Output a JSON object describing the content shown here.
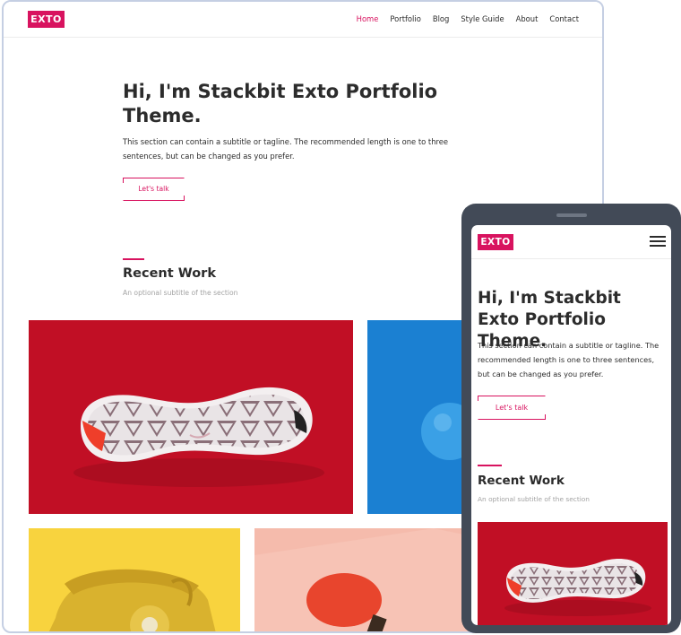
{
  "desktop": {
    "logo": "EXTO",
    "nav": [
      {
        "label": "Home",
        "active": true
      },
      {
        "label": "Portfolio",
        "active": false
      },
      {
        "label": "Blog",
        "active": false
      },
      {
        "label": "Style Guide",
        "active": false
      },
      {
        "label": "About",
        "active": false
      },
      {
        "label": "Contact",
        "active": false
      }
    ],
    "hero": {
      "title": "Hi, I'm Stackbit Exto Portfolio Theme.",
      "subtitle": "This section can contain a subtitle or tagline. The recommended length is one to three sentences, but can be changed as you prefer.",
      "button": "Let's talk"
    },
    "section": {
      "title": "Recent Work",
      "subtitle": "An optional subtitle of the section"
    },
    "portfolio_tiles": [
      {
        "name": "sneaker-sole",
        "bg": "#c10f25"
      },
      {
        "name": "blue-ball",
        "bg": "#1b80d2"
      },
      {
        "name": "yellow-telephone",
        "bg": "#f8d33e"
      },
      {
        "name": "ping-pong-paddle",
        "bg": "#f7c3b5"
      }
    ]
  },
  "mobile": {
    "logo": "EXTO",
    "menu_icon": "hamburger-icon",
    "hero": {
      "title": "Hi, I'm Stackbit Exto Portfolio Theme.",
      "subtitle": "This section can contain a subtitle or tagline. The recommended length is one to three sentences, but can be changed as you prefer.",
      "button": "Let's talk"
    },
    "section": {
      "title": "Recent Work",
      "subtitle": "An optional subtitle of the section"
    }
  },
  "colors": {
    "accent": "#d8135f",
    "text": "#2c2c2c",
    "muted": "#a3a3a3",
    "device_frame": "#424a57"
  }
}
